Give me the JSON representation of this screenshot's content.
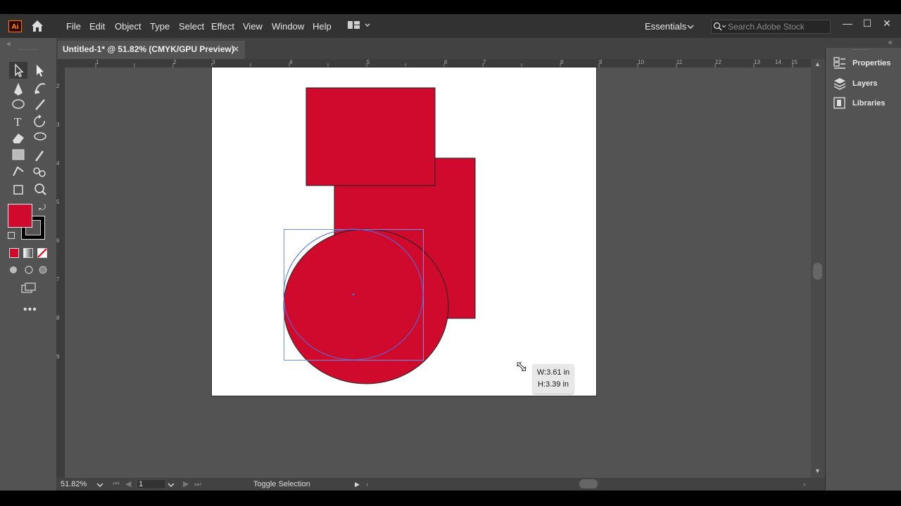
{
  "app": {
    "logo": "Ai",
    "menu": [
      "File",
      "Edit",
      "Object",
      "Type",
      "Select",
      "Effect",
      "View",
      "Window",
      "Help"
    ],
    "workspace": "Essentials",
    "search_placeholder": "Search Adobe Stock"
  },
  "document": {
    "tab_title": "Untitled-1* @ 51.82% (CMYK/GPU Preview)",
    "tab_close": "✕"
  },
  "colors": {
    "fill": "#cf0a2c",
    "accent": "#ff9a00",
    "selection": "#4b6ee6"
  },
  "ruler": {
    "top": [
      "1",
      "2",
      "3",
      "4",
      "5",
      "6",
      "7",
      "8",
      "9",
      "10",
      "11",
      "12",
      "13",
      "14",
      "15"
    ],
    "left": [
      "2",
      "3",
      "4",
      "5",
      "6",
      "7",
      "8",
      "9"
    ]
  },
  "tooltip": {
    "width": "W:3.61 in",
    "height": "H:3.39 in"
  },
  "status": {
    "zoom": "51.82%",
    "artboard": "1",
    "message": "Toggle Selection"
  },
  "panels": [
    {
      "icon": "properties-icon",
      "label": "Properties"
    },
    {
      "icon": "layers-icon",
      "label": "Layers"
    },
    {
      "icon": "libraries-icon",
      "label": "Libraries"
    }
  ],
  "tools": [
    "selection-tool",
    "direct-selection-tool",
    "pen-tool",
    "curvature-tool",
    "ellipse-tool",
    "paintbrush-tool",
    "type-tool",
    "rotate-tool",
    "eraser-tool",
    "lasso-tool",
    "gradient-tool",
    "eyedropper-tool",
    "puppet-warp-tool",
    "shape-builder-tool",
    "artboard-tool",
    "zoom-tool"
  ]
}
